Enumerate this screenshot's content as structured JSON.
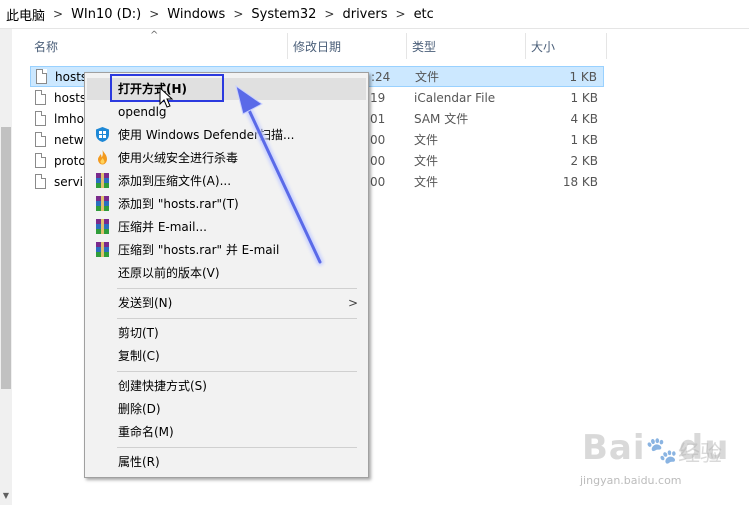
{
  "breadcrumb": [
    "此电脑",
    "WIn10 (D:)",
    "Windows",
    "System32",
    "drivers",
    "etc"
  ],
  "breadcrumb_separator": ">",
  "columns": {
    "name": "名称",
    "date": "修改日期",
    "type": "类型",
    "size": "大小"
  },
  "files": [
    {
      "name": "hosts",
      "date": ":24",
      "type": "文件",
      "size": "1 KB"
    },
    {
      "name": "hosts",
      "date": "19",
      "type": "iCalendar File",
      "size": "1 KB"
    },
    {
      "name": "lmho",
      "date": "01",
      "type": "SAM 文件",
      "size": "4 KB"
    },
    {
      "name": "netw",
      "date": "00",
      "type": "文件",
      "size": "1 KB"
    },
    {
      "name": "proto",
      "date": "00",
      "type": "文件",
      "size": "2 KB"
    },
    {
      "name": "servi",
      "date": "00",
      "type": "文件",
      "size": "18 KB"
    }
  ],
  "context_menu": {
    "open_with": "打开方式(H)",
    "opendlg": "opendlg",
    "defender": "使用 Windows Defender扫描...",
    "huorong": "使用火绒安全进行杀毒",
    "add_archive": "添加到压缩文件(A)...",
    "add_rar": "添加到 \"hosts.rar\"(T)",
    "compress_email": "压缩并 E-mail...",
    "compress_rar_email": "压缩到 \"hosts.rar\" 并 E-mail",
    "restore_versions": "还原以前的版本(V)",
    "send_to": "发送到(N)",
    "cut": "剪切(T)",
    "copy": "复制(C)",
    "create_shortcut": "创建快捷方式(S)",
    "delete": "删除(D)",
    "rename": "重命名(M)",
    "properties": "属性(R)"
  },
  "colors": {
    "annotation": "#2b3adf",
    "selection": "#cce8ff",
    "menu_bg": "#f2f2f2"
  },
  "watermark": {
    "brand": "Bai",
    "paw": "du",
    "cn": "经验",
    "url": "jingyan.baidu.com"
  }
}
